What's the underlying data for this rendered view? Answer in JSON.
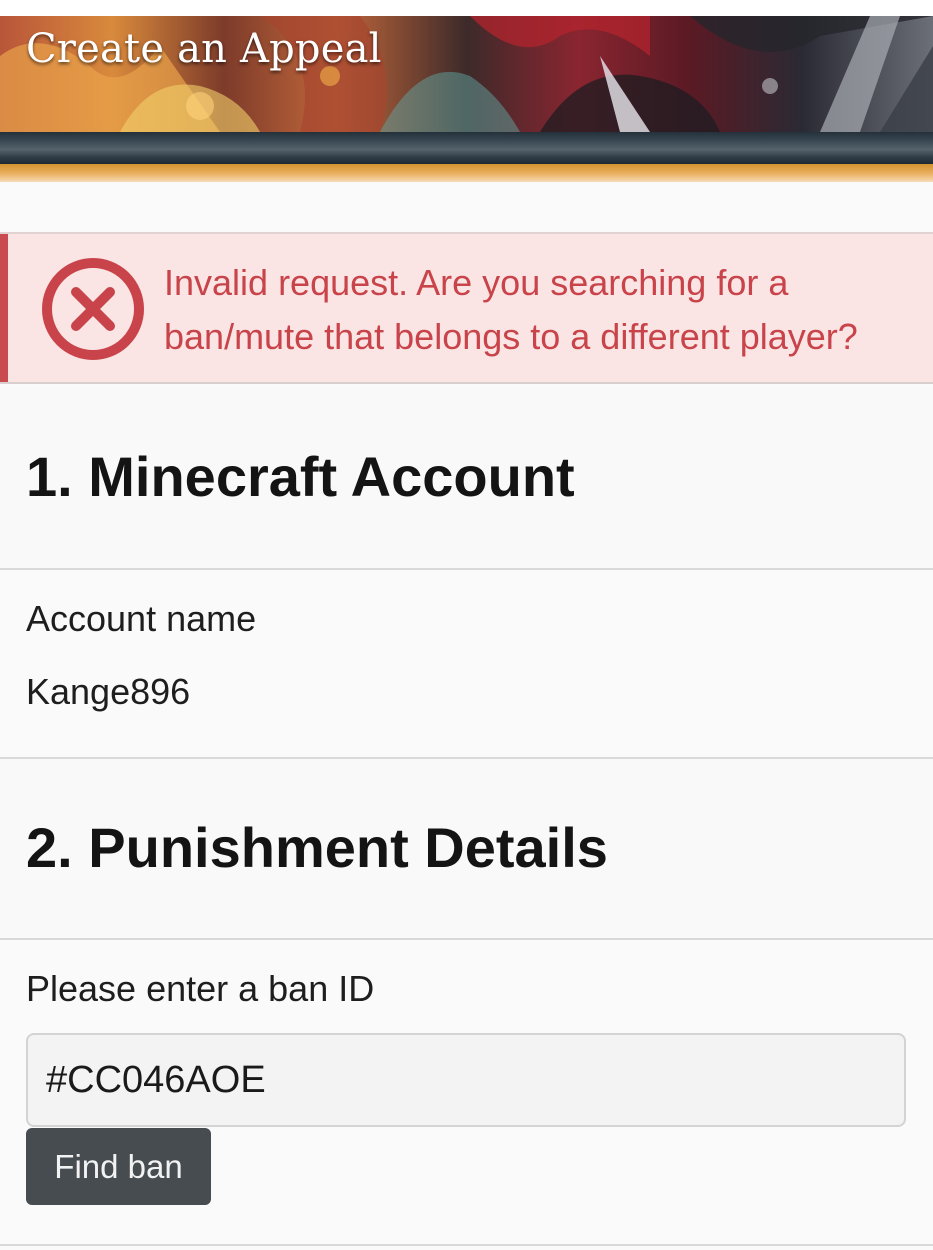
{
  "header": {
    "title": "Create an Appeal"
  },
  "alert": {
    "icon": "x-circle-icon",
    "message": "Invalid request. Are you searching for a ban/mute that belongs to a different player?",
    "color": "#c8444a",
    "background": "#fbe4e4"
  },
  "sections": {
    "account": {
      "title": "1. Minecraft Account",
      "label": "Account name",
      "value": "Kange896"
    },
    "punishment": {
      "title": "2. Punishment Details",
      "label": "Please enter a ban ID",
      "input_value": "#CC046AOE",
      "button_label": "Find ban"
    }
  }
}
